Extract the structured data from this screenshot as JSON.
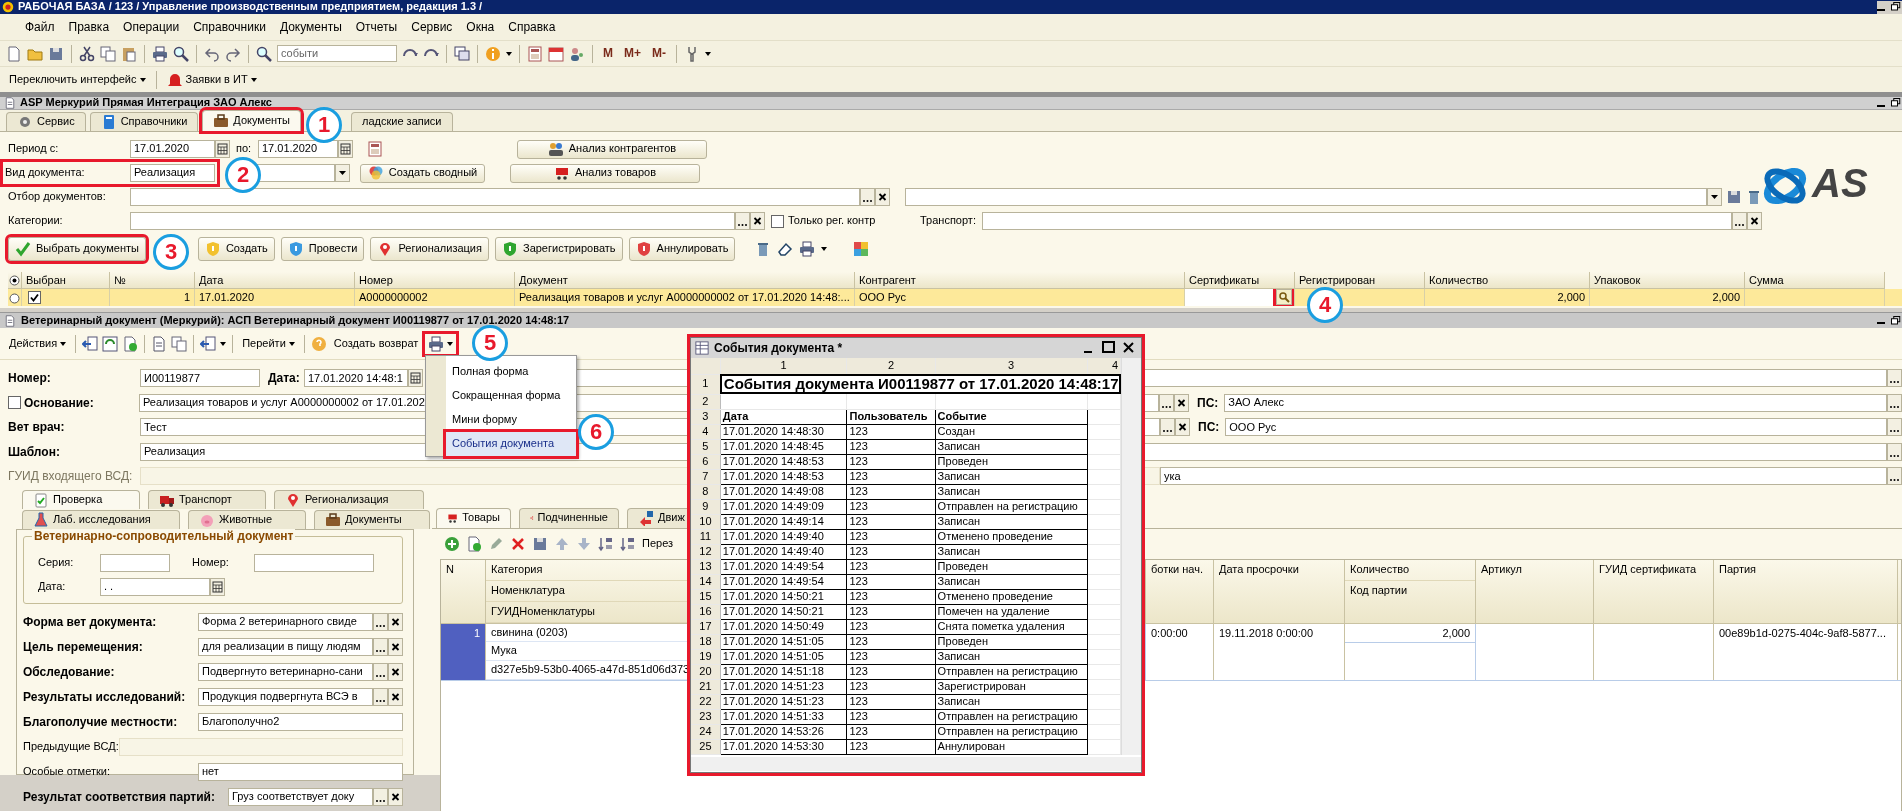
{
  "window": {
    "title": "РАБОЧАЯ БАЗА / 123 / Управление производственным предприятием, редакция 1.3 /"
  },
  "menu": [
    "Файл",
    "Правка",
    "Операции",
    "Справочники",
    "Документы",
    "Отчеты",
    "Сервис",
    "Окна",
    "Справка"
  ],
  "toolbar": {
    "search_value": "событи",
    "marks": [
      "M",
      "M+",
      "M-"
    ]
  },
  "toolbar2": [
    "Переключить интерфейс",
    "Заявки в ИТ"
  ],
  "app_window": {
    "title": "ASP Меркурий Прямая Интеграция ЗАО Алекс"
  },
  "tabs": [
    {
      "label": "Сервис",
      "selected": false,
      "highlighted": false
    },
    {
      "label": "Справочники",
      "selected": false,
      "highlighted": false
    },
    {
      "label": "Документы",
      "selected": true,
      "highlighted": true
    },
    {
      "label": "ладские записи",
      "selected": false,
      "highlighted": false
    }
  ],
  "filters": {
    "period_label": "Период с:",
    "date_from": "17.01.2020",
    "to_label": "по:",
    "date_to": "17.01.2020",
    "doc_type_label": "Вид документа:",
    "doc_type": "Реализация",
    "doc_type_highlighted": true,
    "selection_label": "Отбор документов:",
    "categories_label": "Категории:",
    "only_reg_label": "Только рег. контр",
    "only_reg_checked": false,
    "transport_label": "Транспорт:",
    "analysis_partners": "Анализ контрагентов",
    "create_summary": "Создать сводный",
    "analysis_goods": "Анализ товаров",
    "logo_text": "AS"
  },
  "actions": [
    {
      "label": "Выбрать документы",
      "highlighted": true
    },
    {
      "label": "Создать",
      "highlighted": false
    },
    {
      "label": "Провести",
      "highlighted": false
    },
    {
      "label": "Регионализация",
      "highlighted": false
    },
    {
      "label": "Зарегистрировать",
      "highlighted": false
    },
    {
      "label": "Аннулировать",
      "highlighted": false
    }
  ],
  "documents_table": {
    "columns": [
      "Выбран",
      "№",
      "Дата",
      "Номер",
      "Документ",
      "Контрагент",
      "Сертификаты",
      "Регистрирован",
      "Количество",
      "Упаковок",
      "Сумма"
    ],
    "rows": [
      {
        "selected": true,
        "checked": true,
        "cert_lookup_highlighted": true,
        "cells": [
          "",
          "1",
          "17.01.2020",
          "А0000000002",
          "Реализация товаров и услуг А0000000002 от 17.01.2020 14:48:...",
          "ООО Рус",
          "",
          "",
          "2,000",
          "2,000",
          ""
        ]
      }
    ]
  },
  "vet_doc": {
    "title": "Ветеринарный документ (Меркурий): АСП Ветеринарный документ И00119877 от 17.01.2020 14:48:17",
    "actions_label": "Действия",
    "goto_label": "Перейти",
    "return_label": "Создать возврат",
    "print_highlighted": true
  },
  "print_menu": {
    "items": [
      {
        "label": "Полная форма",
        "selected": false,
        "highlighted": false
      },
      {
        "label": "Сокращенная форма",
        "selected": false,
        "highlighted": false
      },
      {
        "label": "Мини форму",
        "selected": false,
        "highlighted": false
      },
      {
        "label": "События документа",
        "selected": true,
        "highlighted": true
      }
    ]
  },
  "form": {
    "number_label": "Номер:",
    "number": "И00119877",
    "date_label": "Дата:",
    "date": "17.01.2020 14:48:1",
    "basis_label": "Основание:",
    "basis_checked": false,
    "basis": "Реализация товаров и услуг А0000000002 от 17.01.202",
    "vet_label": "Вет врач:",
    "vet": "Тест",
    "template_label": "Шаблон:",
    "template": "Реализация",
    "guid_label": "ГУИД входящего ВСД:",
    "guid_side": "ука",
    "ps_rows": [
      {
        "label": "ПС:",
        "value": "ЗАО Алекс"
      },
      {
        "label": "ПС:",
        "value": "ООО Рус"
      }
    ]
  },
  "left_tabs": [
    {
      "label": "Проверка",
      "selected": true
    },
    {
      "label": "Транспорт",
      "selected": false
    },
    {
      "label": "Регионализация",
      "selected": false
    },
    {
      "label": "Лаб. исследования",
      "selected": false
    },
    {
      "label": "Животные",
      "selected": false
    },
    {
      "label": "Документы",
      "selected": false
    }
  ],
  "vsd_group": {
    "title": "Ветеринарно-сопроводительный документ",
    "series_label": "Серия:",
    "number_label": "Номер:",
    "date_label": "Дата:",
    "date": ". ."
  },
  "left_fields": [
    {
      "kind": "ref",
      "label": "Форма вет документа:",
      "value": "Форма 2 ветеринарного свиде"
    },
    {
      "kind": "ref",
      "label": "Цель перемещения:",
      "value": "для реализации в пищу людям"
    },
    {
      "kind": "ref",
      "label": "Обследование:",
      "value": "Подвергнуто ветеринарно-сани"
    },
    {
      "kind": "ref",
      "label": "Результаты исследований:",
      "value": "Продукция подвергнута ВСЭ в"
    },
    {
      "kind": "text",
      "label": "Благополучие местности:",
      "value": "Благополучно2"
    },
    {
      "kind": "disabled",
      "label": "Предыдущие ВСД:"
    },
    {
      "kind": "note",
      "label": "Особые отметки:",
      "value": "нет"
    },
    {
      "kind": "wide",
      "label": "Результат соответствия партий:",
      "value": "Груз соответствует доку"
    }
  ],
  "right_tabs": [
    {
      "label": "Товары",
      "selected": true
    },
    {
      "label": "Подчиненные",
      "selected": false
    },
    {
      "label": "Движ",
      "selected": false
    }
  ],
  "goods_toolbar": {
    "cut_label": "Перез"
  },
  "goods_table": {
    "columns": [
      "N",
      "Категория",
      "Номенклатура",
      "ГУИДНоменклатуры",
      "ботки нач.",
      "Дата просрочки",
      "Количество",
      "Код партии",
      "Артикул",
      "ГУИД сертификата",
      "Партия"
    ],
    "rows": [
      {
        "selected": true,
        "n": "1",
        "category": "свинина (0203)",
        "nomenclature": "Мука",
        "guid": "d327e5b9-53b0-4065-a47d-851d06d373",
        "start": "0:00:00",
        "expiry": "19.11.2018 0:00:00",
        "quantity": "2,000",
        "article": "",
        "cert_guid": "",
        "batch": "00e89b1d-0275-404c-9af8-5877..."
      }
    ]
  },
  "events_window": {
    "title": "События документа *",
    "highlighted": true,
    "col_headers": [
      "1",
      "2",
      "3",
      "4"
    ],
    "row_numbers": [
      "1",
      "2",
      "3"
    ],
    "heading": "События документа И00119877 от 17.01.2020 14:48:17",
    "headers": [
      "Дата",
      "Пользователь",
      "Событие"
    ],
    "rows": [
      {
        "n": "4",
        "date": "17.01.2020 14:48:30",
        "user": "123",
        "event": "Создан"
      },
      {
        "n": "5",
        "date": "17.01.2020 14:48:45",
        "user": "123",
        "event": "Записан"
      },
      {
        "n": "6",
        "date": "17.01.2020 14:48:53",
        "user": "123",
        "event": "Проведен"
      },
      {
        "n": "7",
        "date": "17.01.2020 14:48:53",
        "user": "123",
        "event": "Записан"
      },
      {
        "n": "8",
        "date": "17.01.2020 14:49:08",
        "user": "123",
        "event": "Записан"
      },
      {
        "n": "9",
        "date": "17.01.2020 14:49:09",
        "user": "123",
        "event": "Отправлен на регистрацию"
      },
      {
        "n": "10",
        "date": "17.01.2020 14:49:14",
        "user": "123",
        "event": "Записан"
      },
      {
        "n": "11",
        "date": "17.01.2020 14:49:40",
        "user": "123",
        "event": "Отменено проведение"
      },
      {
        "n": "12",
        "date": "17.01.2020 14:49:40",
        "user": "123",
        "event": "Записан"
      },
      {
        "n": "13",
        "date": "17.01.2020 14:49:54",
        "user": "123",
        "event": "Проведен"
      },
      {
        "n": "14",
        "date": "17.01.2020 14:49:54",
        "user": "123",
        "event": "Записан"
      },
      {
        "n": "15",
        "date": "17.01.2020 14:50:21",
        "user": "123",
        "event": "Отменено проведение"
      },
      {
        "n": "16",
        "date": "17.01.2020 14:50:21",
        "user": "123",
        "event": "Помечен на удаление"
      },
      {
        "n": "17",
        "date": "17.01.2020 14:50:49",
        "user": "123",
        "event": "Снята пометка удаления"
      },
      {
        "n": "18",
        "date": "17.01.2020 14:51:05",
        "user": "123",
        "event": "Проведен"
      },
      {
        "n": "19",
        "date": "17.01.2020 14:51:05",
        "user": "123",
        "event": "Записан"
      },
      {
        "n": "20",
        "date": "17.01.2020 14:51:18",
        "user": "123",
        "event": "Отправлен на регистрацию"
      },
      {
        "n": "21",
        "date": "17.01.2020 14:51:23",
        "user": "123",
        "event": "Зарегистрирован"
      },
      {
        "n": "22",
        "date": "17.01.2020 14:51:23",
        "user": "123",
        "event": "Записан"
      },
      {
        "n": "23",
        "date": "17.01.2020 14:51:33",
        "user": "123",
        "event": "Отправлен на регистрацию"
      },
      {
        "n": "24",
        "date": "17.01.2020 14:53:26",
        "user": "123",
        "event": "Отправлен на регистрацию"
      },
      {
        "n": "25",
        "date": "17.01.2020 14:53:30",
        "user": "123",
        "event": "Аннулирован"
      }
    ]
  },
  "annotations": [
    {
      "number": "1"
    },
    {
      "number": "2"
    },
    {
      "number": "3"
    },
    {
      "number": "4"
    },
    {
      "number": "5"
    },
    {
      "number": "6"
    }
  ]
}
